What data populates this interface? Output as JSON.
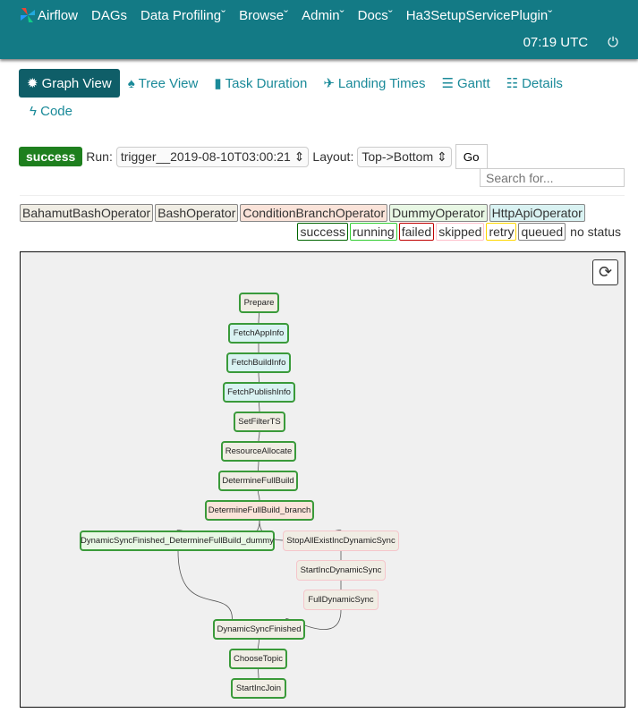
{
  "nav": {
    "brand": "Airflow",
    "items": [
      "DAGs",
      "Data Profilingˇ",
      "Browseˇ",
      "Adminˇ",
      "Docsˇ",
      "Ha3SetupServicePluginˇ"
    ],
    "time": "07:19 UTC"
  },
  "tabs": [
    {
      "label": "Graph View",
      "icon": "asterisk-icon"
    },
    {
      "label": "Tree View",
      "icon": "tree-icon"
    },
    {
      "label": "Task Duration",
      "icon": "bar-chart-icon"
    },
    {
      "label": "Landing Times",
      "icon": "plane-icon"
    },
    {
      "label": "Gantt",
      "icon": "align-left-icon"
    },
    {
      "label": "Details",
      "icon": "list-icon"
    }
  ],
  "code_tab": "Code",
  "controls": {
    "state": "success",
    "run_label": "Run:",
    "run_value": "trigger__2019-08-10T03:00:21",
    "layout_label": "Layout:",
    "layout_value": "Top->Bottom",
    "go": "Go",
    "search_placeholder": "Search for..."
  },
  "operators": [
    {
      "name": "BahamutBashOperator",
      "color": "#f0ede4"
    },
    {
      "name": "BashOperator",
      "color": "#f0ede4"
    },
    {
      "name": "ConditionBranchOperator",
      "color": "#fae3d9"
    },
    {
      "name": "DummyOperator",
      "color": "#e8f7e4"
    },
    {
      "name": "HttpApiOperator",
      "color": "#d9f2f2"
    }
  ],
  "states": [
    {
      "name": "success",
      "color": "#006400"
    },
    {
      "name": "running",
      "color": "#32cd32"
    },
    {
      "name": "failed",
      "color": "#c00000"
    },
    {
      "name": "skipped",
      "color": "#ffc0cb"
    },
    {
      "name": "retry",
      "color": "#ffd700"
    },
    {
      "name": "queued",
      "color": "#808080"
    },
    {
      "name": "no status",
      "color": "#ffffff"
    }
  ],
  "tasks": [
    {
      "id": "Prepare",
      "op": "BashOperator",
      "state": "success"
    },
    {
      "id": "FetchAppInfo",
      "op": "HttpApiOperator",
      "state": "success"
    },
    {
      "id": "FetchBuildInfo",
      "op": "HttpApiOperator",
      "state": "success"
    },
    {
      "id": "FetchPublishInfo",
      "op": "HttpApiOperator",
      "state": "success"
    },
    {
      "id": "SetFilterTS",
      "op": "BashOperator",
      "state": "success"
    },
    {
      "id": "ResourceAllocate",
      "op": "BashOperator",
      "state": "success"
    },
    {
      "id": "DetermineFullBuild",
      "op": "BashOperator",
      "state": "success"
    },
    {
      "id": "DetermineFullBuild_branch",
      "op": "ConditionBranchOperator",
      "state": "success"
    },
    {
      "id": "DynamicSyncFinished_DetermineFullBuild_dummy",
      "op": "DummyOperator",
      "state": "success"
    },
    {
      "id": "StopAllExistIncDynamicSync",
      "op": "BashOperator",
      "state": "skipped"
    },
    {
      "id": "StartIncDynamicSync",
      "op": "BashOperator",
      "state": "skipped"
    },
    {
      "id": "FullDynamicSync",
      "op": "BashOperator",
      "state": "skipped"
    },
    {
      "id": "DynamicSyncFinished",
      "op": "BashOperator",
      "state": "success"
    },
    {
      "id": "ChooseTopic",
      "op": "BashOperator",
      "state": "success"
    },
    {
      "id": "StartIncJoin",
      "op": "BashOperator",
      "state": "success"
    }
  ],
  "edges": [
    [
      0,
      1
    ],
    [
      1,
      2
    ],
    [
      2,
      3
    ],
    [
      3,
      4
    ],
    [
      4,
      5
    ],
    [
      5,
      6
    ],
    [
      6,
      7
    ],
    [
      7,
      8
    ],
    [
      7,
      9
    ],
    [
      9,
      10
    ],
    [
      10,
      11
    ],
    [
      8,
      12
    ],
    [
      11,
      12
    ],
    [
      12,
      13
    ],
    [
      13,
      14
    ]
  ]
}
